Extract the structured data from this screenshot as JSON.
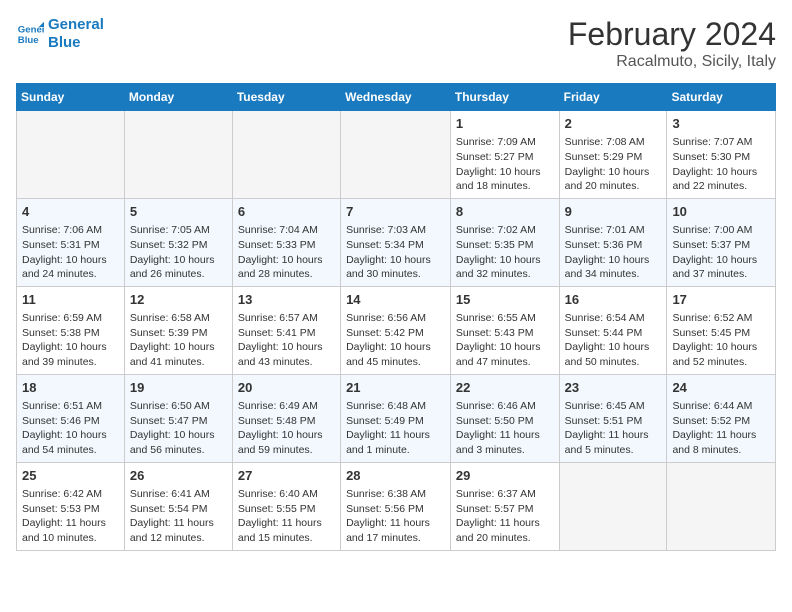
{
  "logo": {
    "line1": "General",
    "line2": "Blue"
  },
  "title": "February 2024",
  "subtitle": "Racalmuto, Sicily, Italy",
  "days_of_week": [
    "Sunday",
    "Monday",
    "Tuesday",
    "Wednesday",
    "Thursday",
    "Friday",
    "Saturday"
  ],
  "weeks": [
    [
      {
        "day": "",
        "info": ""
      },
      {
        "day": "",
        "info": ""
      },
      {
        "day": "",
        "info": ""
      },
      {
        "day": "",
        "info": ""
      },
      {
        "day": "1",
        "info": "Sunrise: 7:09 AM\nSunset: 5:27 PM\nDaylight: 10 hours and 18 minutes."
      },
      {
        "day": "2",
        "info": "Sunrise: 7:08 AM\nSunset: 5:29 PM\nDaylight: 10 hours and 20 minutes."
      },
      {
        "day": "3",
        "info": "Sunrise: 7:07 AM\nSunset: 5:30 PM\nDaylight: 10 hours and 22 minutes."
      }
    ],
    [
      {
        "day": "4",
        "info": "Sunrise: 7:06 AM\nSunset: 5:31 PM\nDaylight: 10 hours and 24 minutes."
      },
      {
        "day": "5",
        "info": "Sunrise: 7:05 AM\nSunset: 5:32 PM\nDaylight: 10 hours and 26 minutes."
      },
      {
        "day": "6",
        "info": "Sunrise: 7:04 AM\nSunset: 5:33 PM\nDaylight: 10 hours and 28 minutes."
      },
      {
        "day": "7",
        "info": "Sunrise: 7:03 AM\nSunset: 5:34 PM\nDaylight: 10 hours and 30 minutes."
      },
      {
        "day": "8",
        "info": "Sunrise: 7:02 AM\nSunset: 5:35 PM\nDaylight: 10 hours and 32 minutes."
      },
      {
        "day": "9",
        "info": "Sunrise: 7:01 AM\nSunset: 5:36 PM\nDaylight: 10 hours and 34 minutes."
      },
      {
        "day": "10",
        "info": "Sunrise: 7:00 AM\nSunset: 5:37 PM\nDaylight: 10 hours and 37 minutes."
      }
    ],
    [
      {
        "day": "11",
        "info": "Sunrise: 6:59 AM\nSunset: 5:38 PM\nDaylight: 10 hours and 39 minutes."
      },
      {
        "day": "12",
        "info": "Sunrise: 6:58 AM\nSunset: 5:39 PM\nDaylight: 10 hours and 41 minutes."
      },
      {
        "day": "13",
        "info": "Sunrise: 6:57 AM\nSunset: 5:41 PM\nDaylight: 10 hours and 43 minutes."
      },
      {
        "day": "14",
        "info": "Sunrise: 6:56 AM\nSunset: 5:42 PM\nDaylight: 10 hours and 45 minutes."
      },
      {
        "day": "15",
        "info": "Sunrise: 6:55 AM\nSunset: 5:43 PM\nDaylight: 10 hours and 47 minutes."
      },
      {
        "day": "16",
        "info": "Sunrise: 6:54 AM\nSunset: 5:44 PM\nDaylight: 10 hours and 50 minutes."
      },
      {
        "day": "17",
        "info": "Sunrise: 6:52 AM\nSunset: 5:45 PM\nDaylight: 10 hours and 52 minutes."
      }
    ],
    [
      {
        "day": "18",
        "info": "Sunrise: 6:51 AM\nSunset: 5:46 PM\nDaylight: 10 hours and 54 minutes."
      },
      {
        "day": "19",
        "info": "Sunrise: 6:50 AM\nSunset: 5:47 PM\nDaylight: 10 hours and 56 minutes."
      },
      {
        "day": "20",
        "info": "Sunrise: 6:49 AM\nSunset: 5:48 PM\nDaylight: 10 hours and 59 minutes."
      },
      {
        "day": "21",
        "info": "Sunrise: 6:48 AM\nSunset: 5:49 PM\nDaylight: 11 hours and 1 minute."
      },
      {
        "day": "22",
        "info": "Sunrise: 6:46 AM\nSunset: 5:50 PM\nDaylight: 11 hours and 3 minutes."
      },
      {
        "day": "23",
        "info": "Sunrise: 6:45 AM\nSunset: 5:51 PM\nDaylight: 11 hours and 5 minutes."
      },
      {
        "day": "24",
        "info": "Sunrise: 6:44 AM\nSunset: 5:52 PM\nDaylight: 11 hours and 8 minutes."
      }
    ],
    [
      {
        "day": "25",
        "info": "Sunrise: 6:42 AM\nSunset: 5:53 PM\nDaylight: 11 hours and 10 minutes."
      },
      {
        "day": "26",
        "info": "Sunrise: 6:41 AM\nSunset: 5:54 PM\nDaylight: 11 hours and 12 minutes."
      },
      {
        "day": "27",
        "info": "Sunrise: 6:40 AM\nSunset: 5:55 PM\nDaylight: 11 hours and 15 minutes."
      },
      {
        "day": "28",
        "info": "Sunrise: 6:38 AM\nSunset: 5:56 PM\nDaylight: 11 hours and 17 minutes."
      },
      {
        "day": "29",
        "info": "Sunrise: 6:37 AM\nSunset: 5:57 PM\nDaylight: 11 hours and 20 minutes."
      },
      {
        "day": "",
        "info": ""
      },
      {
        "day": "",
        "info": ""
      }
    ]
  ]
}
